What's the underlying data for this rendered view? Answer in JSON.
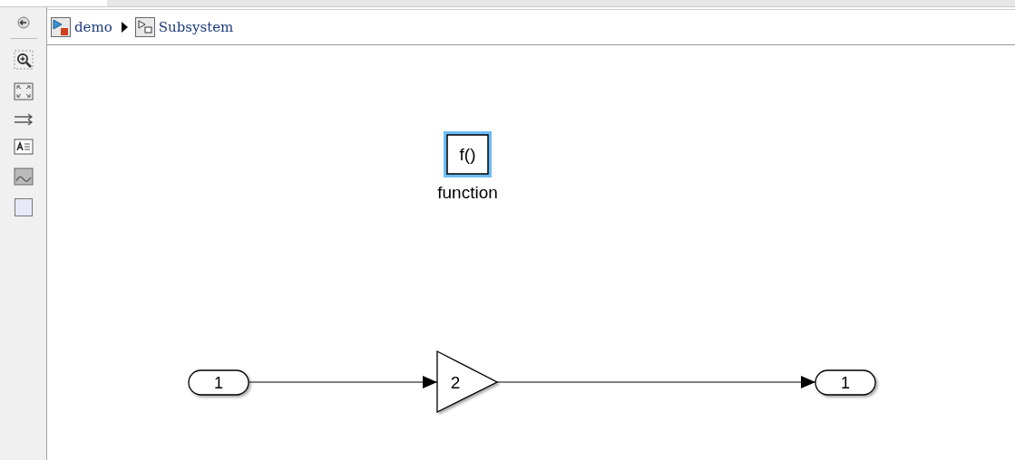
{
  "breadcrumb": [
    {
      "label": "demo",
      "kind": "model"
    },
    {
      "label": "Subsystem",
      "kind": "subsystem"
    }
  ],
  "blocks": [
    {
      "kind": "function",
      "text": "f()",
      "label": "function",
      "selected": true
    },
    {
      "kind": "inport",
      "text": "1",
      "selected": false
    },
    {
      "kind": "gain",
      "text": "2",
      "selected": false
    },
    {
      "kind": "outport",
      "text": "1",
      "selected": false
    }
  ]
}
